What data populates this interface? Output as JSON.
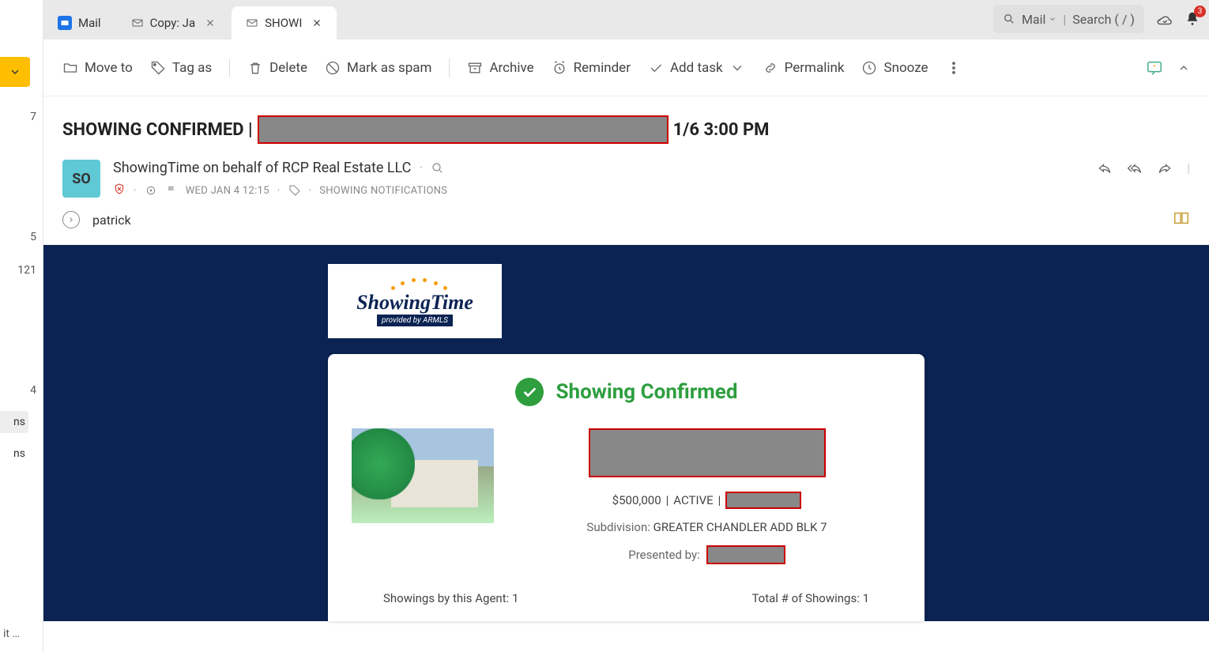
{
  "tabs": [
    {
      "label": "Mail",
      "pinned": true
    },
    {
      "label": "Copy: Ja",
      "closeable": true
    },
    {
      "label": "SHOWI",
      "closeable": true,
      "active": true
    }
  ],
  "search": {
    "scope": "Mail",
    "placeholder": "Search ( / )"
  },
  "notifications_badge": "3",
  "left_rail": {
    "counts": {
      "c7": "7",
      "c5": "5",
      "c121": "121",
      "c4": "4"
    },
    "tags": {
      "t1": "ns",
      "t2": "ns"
    },
    "more": "it …"
  },
  "toolbar": {
    "move_to": "Move to",
    "tag_as": "Tag as",
    "delete": "Delete",
    "spam": "Mark as spam",
    "archive": "Archive",
    "reminder": "Reminder",
    "add_task": "Add task",
    "permalink": "Permalink",
    "snooze": "Snooze"
  },
  "subject": {
    "prefix": "SHOWING CONFIRMED |",
    "suffix": "1/6 3:00 PM"
  },
  "sender": {
    "initials": "SO",
    "name": "ShowingTime on behalf of RCP Real Estate LLC",
    "timestamp": "WED JAN 4 12:15",
    "category": "SHOWING NOTIFICATIONS"
  },
  "recipient": "patrick",
  "body": {
    "logo": {
      "main": "ShowingTime",
      "sub": "provided by ARMLS"
    },
    "headline": "Showing Confirmed",
    "price": "$500,000",
    "status": "ACTIVE",
    "subdivision_label": "Subdivision:",
    "subdivision": "GREATER CHANDLER ADD BLK 7",
    "presented_label": "Presented by:",
    "stat_agent_label": "Showings by this Agent:",
    "stat_agent_value": "1",
    "stat_total_label": "Total # of Showings:",
    "stat_total_value": "1"
  }
}
